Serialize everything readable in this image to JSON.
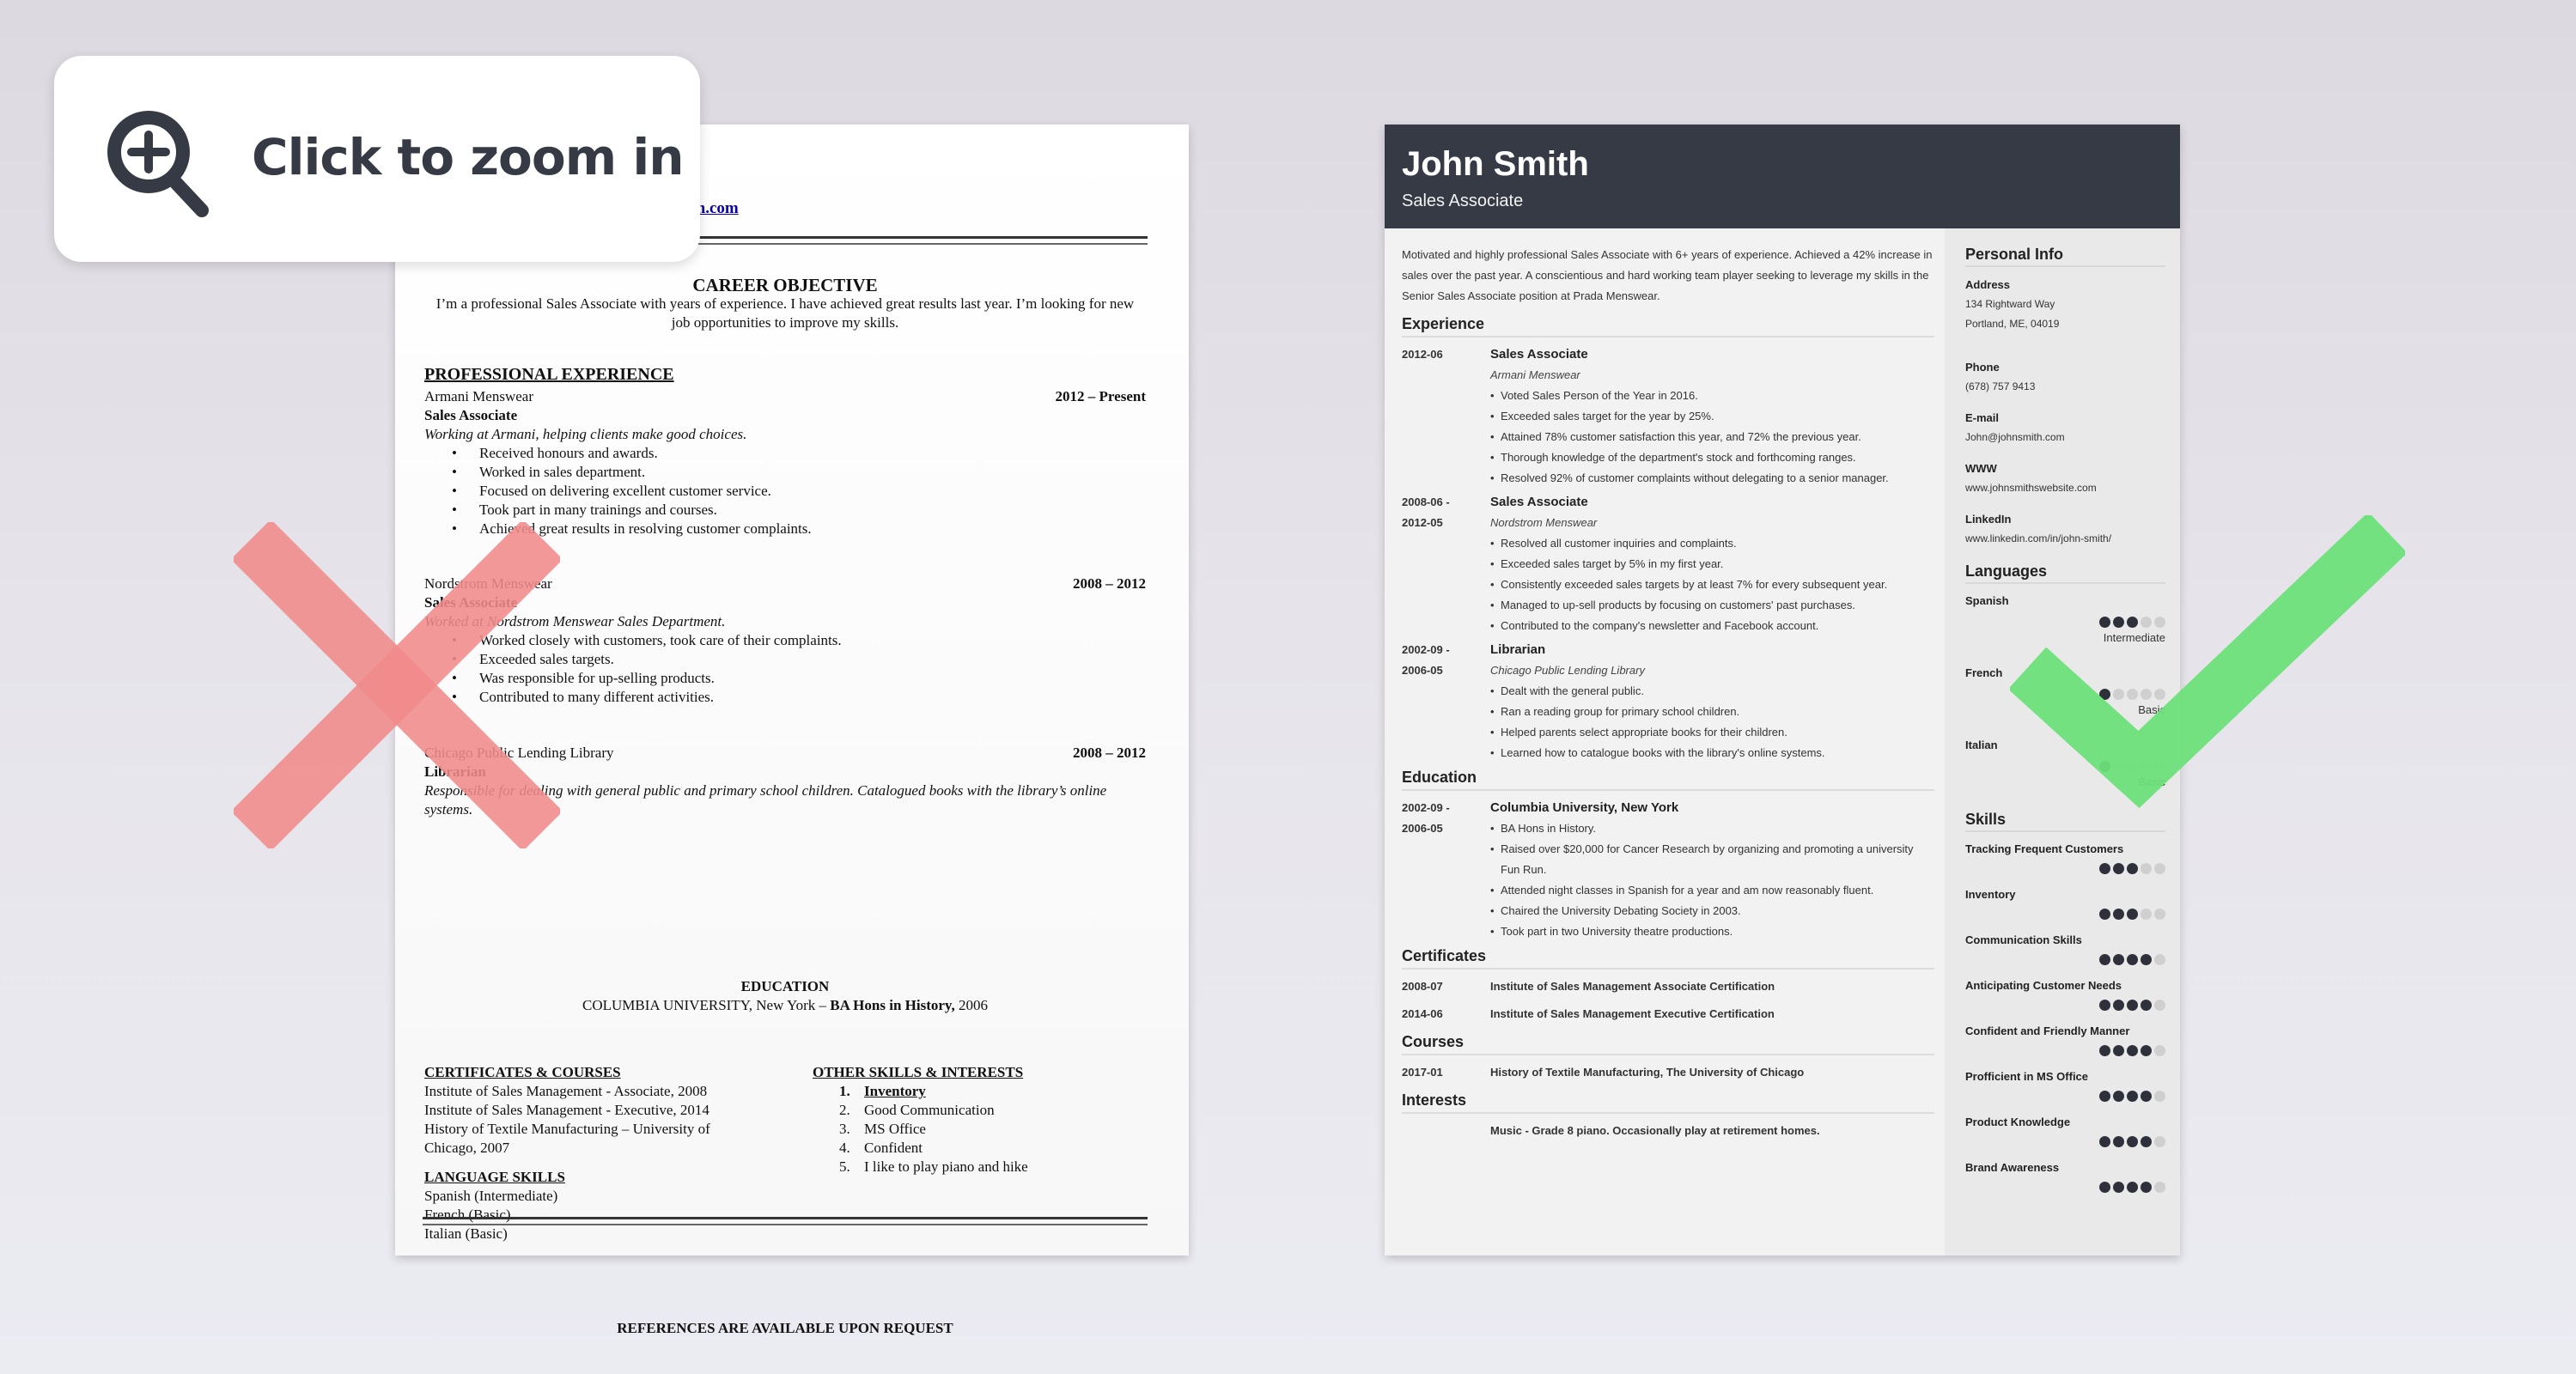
{
  "badge": {
    "label": "Click to zoom in",
    "icon": "zoom-in-icon"
  },
  "marks": {
    "bad": "x-mark-icon",
    "good": "check-mark-icon",
    "bad_color": "#f28b8b",
    "good_color": "#6ee07a"
  },
  "left_resume": {
    "email_partial": "insmith.com",
    "objective_title": "CAREER OBJECTIVE",
    "objective_text": "I’m a professional Sales Associate with years of experience. I have achieved great results last year. I’m looking for new job opportunities to improve my skills.",
    "experience_title": "PROFESSIONAL EXPERIENCE",
    "jobs": [
      {
        "company": "Armani Menswear",
        "dates": "2012 – Present",
        "role": "Sales Associate",
        "description": "Working at Armani, helping clients make good choices.",
        "bullets": [
          "Received honours and awards.",
          "Worked in sales department.",
          "Focused on delivering excellent customer service.",
          "Took part in many trainings and courses.",
          "Achieved great results in resolving customer complaints."
        ]
      },
      {
        "company": "Nordstrom Menswear",
        "dates": "2008 – 2012",
        "role": "Sales Associate",
        "description": "Worked at Nordstrom Menswear Sales Department.",
        "bullets": [
          "Worked closely with customers, took care of their complaints.",
          "Exceeded sales targets.",
          "Was responsible for up-selling products.",
          "Contributed to many different activities."
        ]
      },
      {
        "company": "Chicago Public Lending Library",
        "dates": "2008 – 2012",
        "role": "Librarian",
        "description": "Responsible for dealing with general public and primary school children. Catalogued books with the library’s online systems.",
        "bullets": []
      }
    ],
    "education_title": "EDUCATION",
    "education_school": "COLUMBIA UNIVERSITY, New York  – ",
    "education_degree": "BA Hons in History,",
    "education_year": " 2006",
    "certificates_title": "CERTIFICATES & COURSES",
    "certificates": [
      "Institute of Sales Management - Associate, 2008",
      "Institute of Sales Management  - Executive, 2014",
      "History of Textile Manufacturing – University of Chicago, 2007"
    ],
    "languages_title": "LANGUAGE SKILLS",
    "languages": [
      "Spanish (Intermediate)",
      "French (Basic)",
      "Italian (Basic)"
    ],
    "other_title": "OTHER SKILLS & INTERESTS",
    "other": [
      "Inventory",
      "Good Communication",
      "MS Office",
      "Confident",
      "I like to play piano and hike"
    ],
    "references": "REFERENCES ARE AVAILABLE UPON REQUEST"
  },
  "right_resume": {
    "name": "John Smith",
    "title": "Sales Associate",
    "header_color": "#363a45",
    "summary": "Motivated and highly professional Sales Associate with 6+ years of experience.  Achieved a 42% increase in sales over the past year. A conscientious and hard working team player seeking to leverage my skills in the Senior Sales Associate position at Prada Menswear.",
    "experience_title": "Experience",
    "experience": [
      {
        "date_start": "2012-06",
        "date_end": "",
        "role": "Sales Associate",
        "org": "Armani Menswear",
        "bullets": [
          "Voted Sales Person of the Year in 2016.",
          "Exceeded sales target for the year by 25%.",
          "Attained 78% customer satisfaction this year, and 72% the previous year.",
          "Thorough knowledge of the department's stock and forthcoming ranges.",
          "Resolved 92% of customer complaints without delegating to a senior manager."
        ]
      },
      {
        "date_start": "2008-06 -",
        "date_end": "2012-05",
        "role": "Sales Associate",
        "org": "Nordstrom Menswear",
        "bullets": [
          "Resolved all customer inquiries and complaints.",
          "Exceeded sales target by 5% in my first year.",
          "Consistently exceeded sales targets by at least 7% for every subsequent year.",
          "Managed to up-sell products by focusing on customers' past purchases.",
          "Contributed to the company's newsletter and Facebook account."
        ]
      },
      {
        "date_start": "2002-09 -",
        "date_end": "2006-05",
        "role": "Librarian",
        "org": "Chicago Public Lending Library",
        "bullets": [
          "Dealt with the general public.",
          "Ran a reading group for primary school children.",
          "Helped parents select appropriate books for their children.",
          "Learned how to catalogue books with the library's online systems."
        ]
      }
    ],
    "education_title": "Education",
    "education": {
      "date_start": "2002-09 -",
      "date_end": "2006-05",
      "school": "Columbia University, New York",
      "bullets": [
        "BA Hons in History.",
        "Raised over $20,000 for Cancer Research by organizing and promoting a university Fun Run.",
        "Attended night classes in Spanish for a year and am now reasonably fluent.",
        "Chaired the University Debating Society in 2003.",
        "Took part in two University theatre productions."
      ]
    },
    "certificates_title": "Certificates",
    "certificates": [
      {
        "date": "2008-07",
        "name": "Institute of Sales Management Associate Certification"
      },
      {
        "date": "2014-06",
        "name": "Institute of Sales Management Executive Certification"
      }
    ],
    "courses_title": "Courses",
    "courses": [
      {
        "date": "2017-01",
        "name": "History of Textile Manufacturing, The University of Chicago"
      }
    ],
    "interests_title": "Interests",
    "interests": "Music - Grade 8 piano. Occasionally play at retirement homes.",
    "sidebar": {
      "personal_title": "Personal Info",
      "address_label": "Address",
      "address_line1": "134 Rightward Way",
      "address_line2": "Portland, ME, 04019",
      "phone_label": "Phone",
      "phone": "(678) 757 9413",
      "email_label": "E-mail",
      "email": "John@johnsmith.com",
      "www_label": "WWW",
      "www": "www.johnsmithswebsite.com",
      "linkedin_label": "LinkedIn",
      "linkedin": "www.linkedin.com/in/john-smith/",
      "languages_title": "Languages",
      "languages": [
        {
          "name": "Spanish",
          "level": "Intermediate",
          "rating": 3,
          "max": 5
        },
        {
          "name": "French",
          "level": "Basic",
          "rating": 1,
          "max": 5
        },
        {
          "name": "Italian",
          "level": "Basic",
          "rating": 1,
          "max": 5
        }
      ],
      "skills_title": "Skills",
      "skills": [
        {
          "name": "Tracking Frequent Customers",
          "rating": 3,
          "max": 5
        },
        {
          "name": "Inventory",
          "rating": 3,
          "max": 5
        },
        {
          "name": "Communication Skills",
          "rating": 4,
          "max": 5
        },
        {
          "name": "Anticipating Customer Needs",
          "rating": 4,
          "max": 5
        },
        {
          "name": "Confident and Friendly Manner",
          "rating": 4,
          "max": 5
        },
        {
          "name": "Profficient in MS Office",
          "rating": 4,
          "max": 5
        },
        {
          "name": "Product Knowledge",
          "rating": 4,
          "max": 5
        },
        {
          "name": "Brand Awareness",
          "rating": 4,
          "max": 5
        }
      ]
    }
  }
}
